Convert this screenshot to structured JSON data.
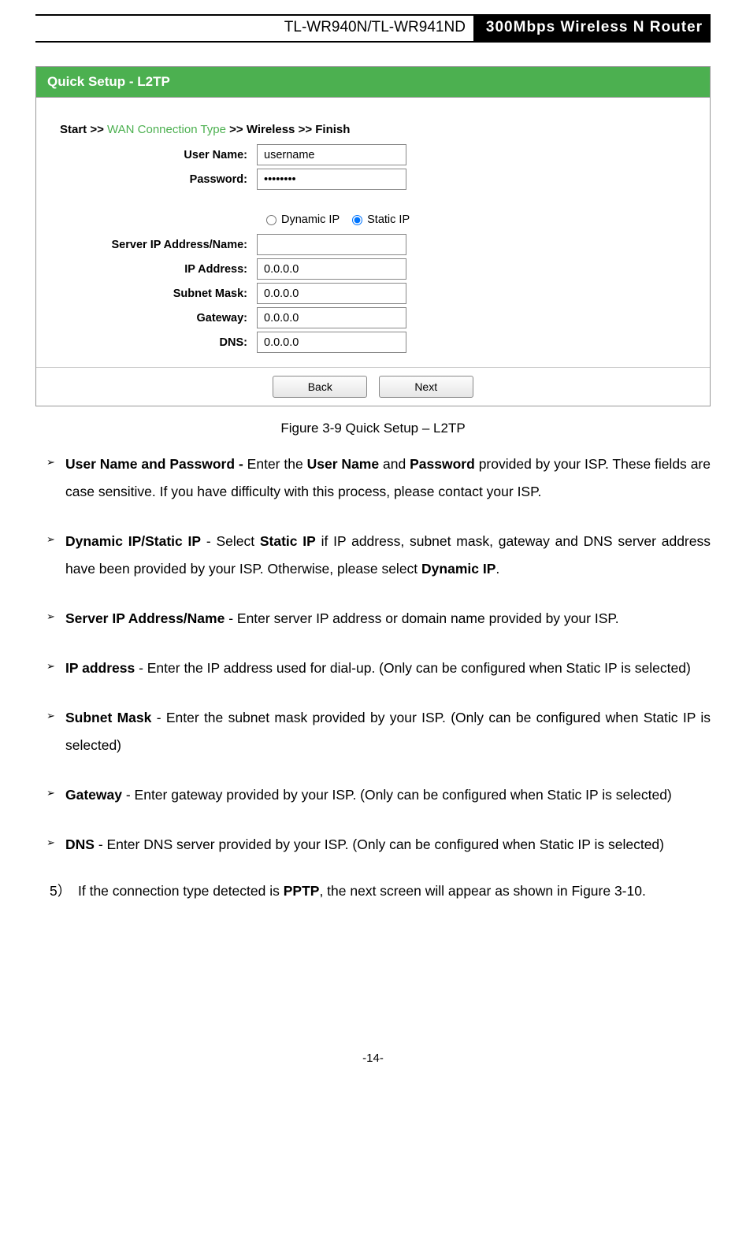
{
  "header": {
    "model": "TL-WR940N/TL-WR941ND",
    "product": "300Mbps Wireless N Router"
  },
  "panel": {
    "title": "Quick Setup - L2TP",
    "crumbs": [
      "Start >>",
      "WAN Connection Type",
      ">> Wireless >> Finish"
    ],
    "fields": {
      "username_label": "User Name:",
      "username_value": "username",
      "password_label": "Password:",
      "password_value": "••••••••",
      "dynamic_ip": "Dynamic IP",
      "static_ip": "Static IP",
      "server_label": "Server IP Address/Name:",
      "server_value": "",
      "ip_label": "IP Address:",
      "ip_value": "0.0.0.0",
      "mask_label": "Subnet Mask:",
      "mask_value": "0.0.0.0",
      "gateway_label": "Gateway:",
      "gateway_value": "0.0.0.0",
      "dns_label": "DNS:",
      "dns_value": "0.0.0.0"
    },
    "buttons": {
      "back": "Back",
      "next": "Next"
    }
  },
  "caption": "Figure 3-9 Quick Setup – L2TP",
  "bullets": {
    "b1_bold": "User Name and Password - ",
    "b1_t1": "Enter the ",
    "b1_b2": "User Name",
    "b1_t2": " and ",
    "b1_b3": "Password",
    "b1_t3": " provided by your ISP. These fields are case sensitive. If you have difficulty with this process, please contact your ISP.",
    "b2_bold": "Dynamic IP/Static IP",
    "b2_t1": " - Select ",
    "b2_b2": "Static IP",
    "b2_t2": " if IP address, subnet mask, gateway and DNS server address have been provided by your ISP. Otherwise, please select ",
    "b2_b3": "Dynamic IP",
    "b2_t3": ".",
    "b3_bold": "Server IP Address/Name",
    "b3_t1": " - Enter server IP address or domain name provided by your ISP.",
    "b4_bold": "IP address",
    "b4_t1": " - Enter the IP address used for dial-up. (Only can be configured when Static IP is selected)",
    "b5_bold": "Subnet Mask",
    "b5_t1": " - Enter the subnet mask provided by your ISP. (Only can be configured when Static IP is selected)",
    "b6_bold": "Gateway",
    "b6_t1": " - Enter gateway provided by your ISP. (Only can be configured when Static IP is selected)",
    "b7_bold": "DNS",
    "b7_t1": " - Enter DNS server provided by your ISP. (Only can be configured when Static IP is selected)"
  },
  "step5": {
    "num": "5）",
    "t1": "If the connection type detected is ",
    "b1": "PPTP",
    "t2": ", the next screen will appear as shown in Figure 3-10."
  },
  "page_no": "-14-"
}
